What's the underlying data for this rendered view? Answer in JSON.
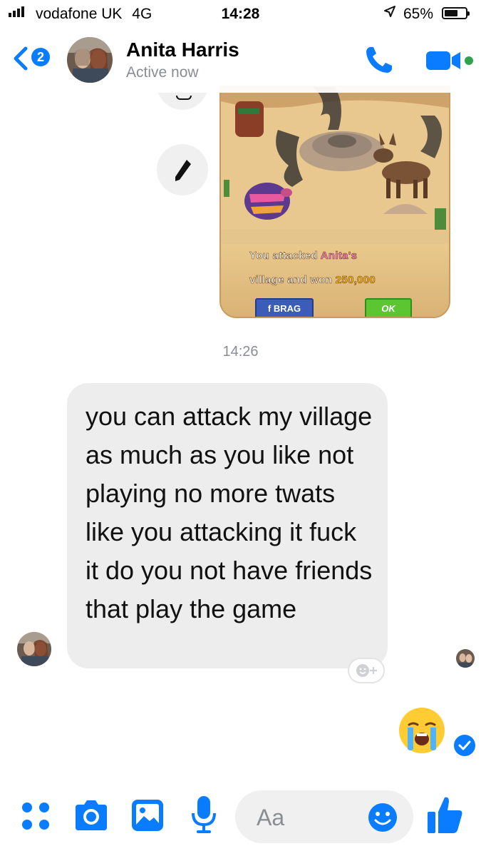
{
  "status_bar": {
    "carrier": "vodafone UK",
    "network": "4G",
    "time": "14:28",
    "battery_percent": "65%",
    "battery_level": 0.65,
    "icons": [
      "signal-bars-icon",
      "location-arrow-icon",
      "battery-icon"
    ]
  },
  "header": {
    "back_badge": "2",
    "contact_name": "Anita Harris",
    "status": "Active now",
    "icons": [
      "back-chevron-icon",
      "phone-icon",
      "video-camera-icon",
      "online-dot-icon"
    ]
  },
  "game_card": {
    "line1_prefix": "You attacked ",
    "line1_name": "Anita's",
    "line2_prefix": "village and won ",
    "line2_amount": "250,000",
    "brag_label": "f BRAG",
    "ok_label": "OK"
  },
  "conversation": {
    "timestamp": "14:26",
    "message": "you can attack my village as much as you like not playing no more twats like you attacking it fuck it do you not have friends that play the game",
    "reply_emoji": "😭"
  },
  "composer": {
    "placeholder": "Aa",
    "icons": [
      "more-dots-icon",
      "camera-icon",
      "image-icon",
      "microphone-icon",
      "emoji-icon",
      "thumbs-up-icon"
    ]
  },
  "colors": {
    "messenger_blue": "#0a7cff",
    "bubble_gray": "#ededed",
    "online_green": "#31a24c"
  }
}
